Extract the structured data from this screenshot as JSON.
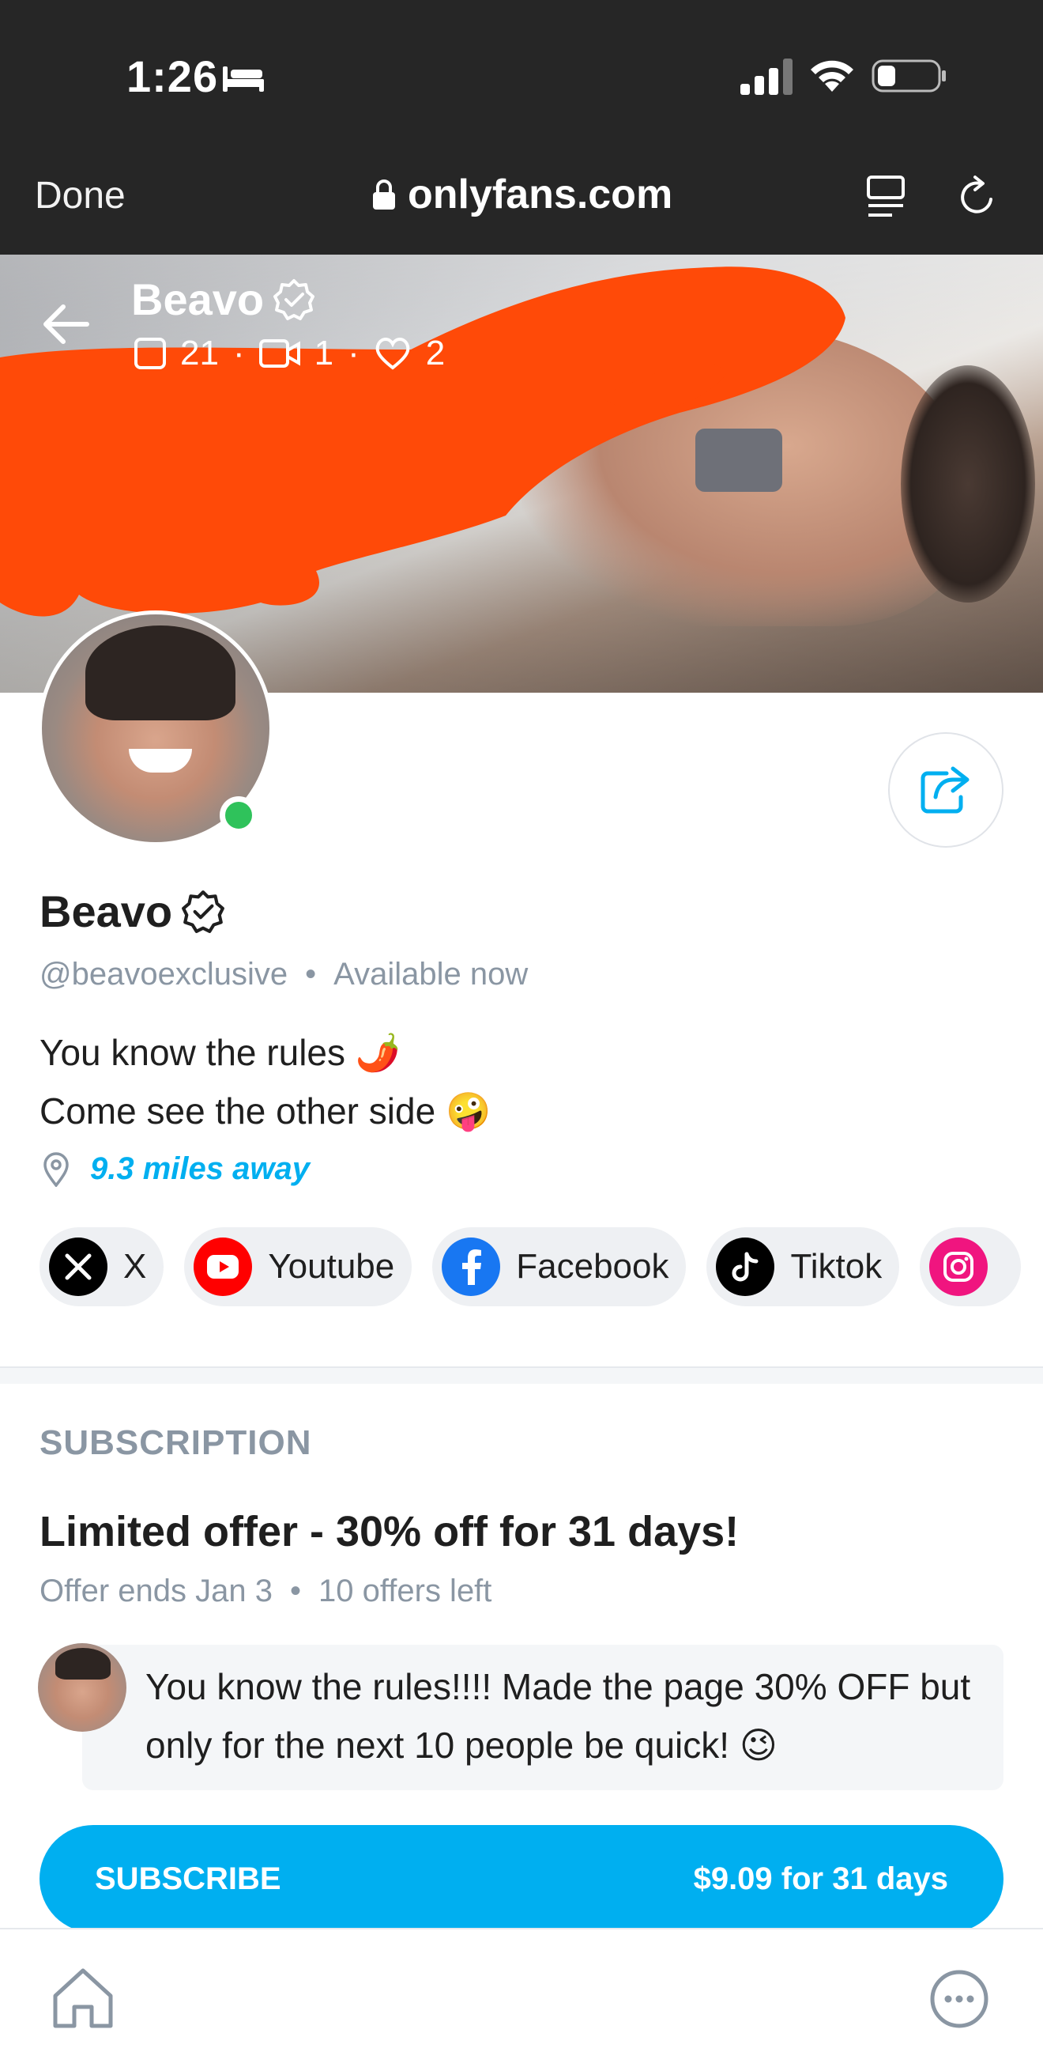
{
  "status_bar": {
    "time": "1:26"
  },
  "browser": {
    "done_label": "Done",
    "url": "onlyfans.com"
  },
  "cover": {
    "name": "Beavo",
    "stats": {
      "photos": "21",
      "videos": "1",
      "likes": "2"
    }
  },
  "profile": {
    "name": "Beavo",
    "handle": "@beavoexclusive",
    "availability": "Available now",
    "bio_line1": "You know the rules 🌶️",
    "bio_line2": "Come see the other side 🤪",
    "location": "9.3 miles away"
  },
  "socials": [
    {
      "label": "X",
      "icon": "x-logo-icon",
      "color": "#000000"
    },
    {
      "label": "Youtube",
      "icon": "youtube-logo-icon",
      "color": "#ff0000"
    },
    {
      "label": "Facebook",
      "icon": "facebook-logo-icon",
      "color": "#1877f2"
    },
    {
      "label": "Tiktok",
      "icon": "tiktok-logo-icon",
      "color": "#000000"
    },
    {
      "label": "",
      "icon": "instagram-logo-icon",
      "color": "#e1306c"
    }
  ],
  "subscription": {
    "section_label": "SUBSCRIPTION",
    "offer_title": "Limited offer - 30% off for 31 days!",
    "offer_ends": "Offer ends Jan 3",
    "offers_left": "10 offers left",
    "message": "You know the rules!!!! Made the page 30% OFF but only for the next 10 people be quick! 😉",
    "button_label": "SUBSCRIBE",
    "button_price": "$9.09 for 31 days"
  },
  "colors": {
    "accent": "#00aff0",
    "online": "#2fc25b",
    "muted": "#8a96a3",
    "redaction": "#ff4500"
  }
}
